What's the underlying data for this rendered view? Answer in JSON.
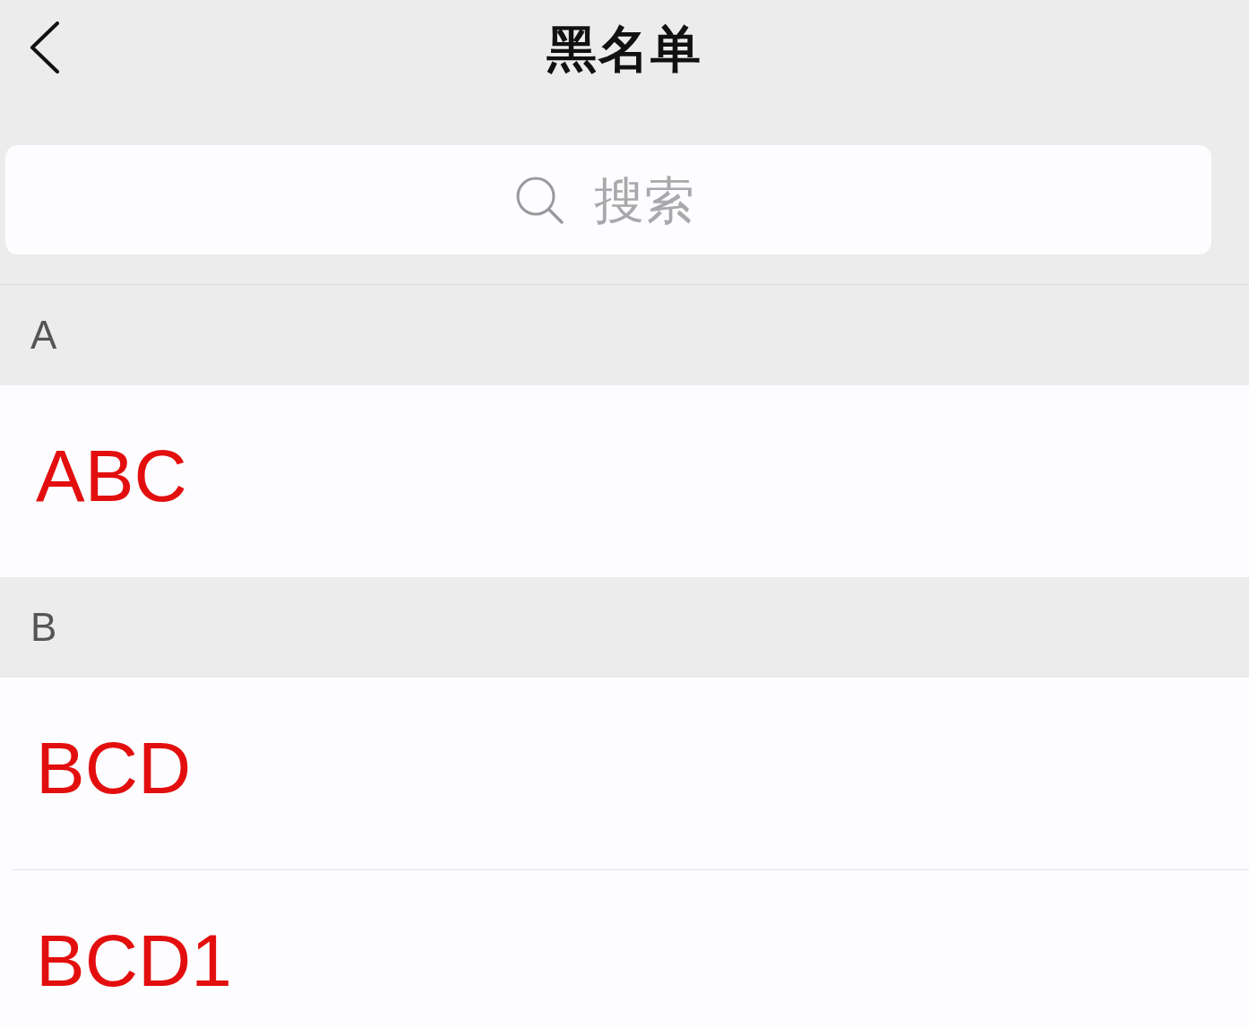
{
  "nav_bar": {
    "title": "黑名单"
  },
  "search": {
    "placeholder": "搜索"
  },
  "sections": [
    {
      "header": "A",
      "contacts": [
        {
          "name": "ABC"
        }
      ]
    },
    {
      "header": "B",
      "contacts": [
        {
          "name": "BCD"
        },
        {
          "name": "BCD1"
        }
      ]
    }
  ]
}
